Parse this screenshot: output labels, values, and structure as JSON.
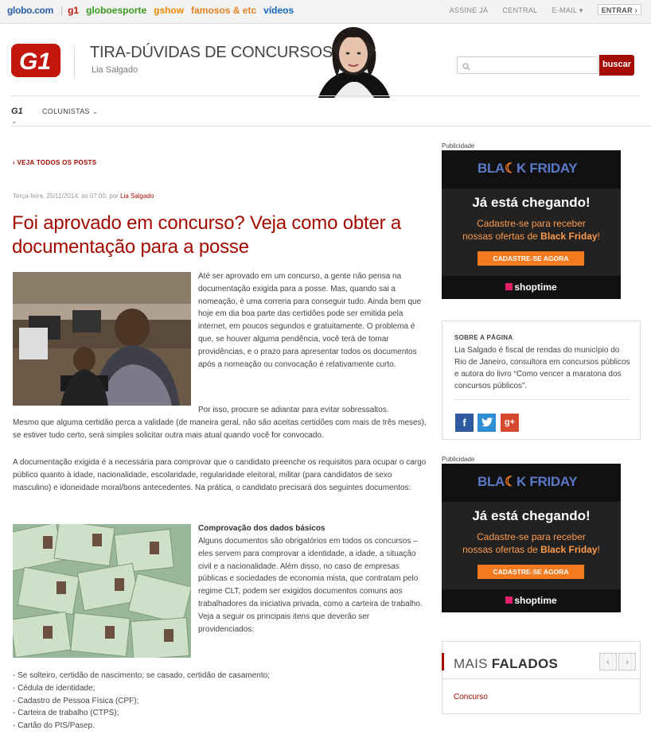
{
  "globobar": {
    "links": [
      "globo.com",
      "g1",
      "globoesporte",
      "gshow",
      "famosos & etc",
      "vídeos"
    ],
    "right": [
      "ASSINE JÁ",
      "CENTRAL",
      "E-MAIL",
      "ENTRAR"
    ]
  },
  "header": {
    "blog_title": "TIRA-DÚVIDAS DE CONCURSOS",
    "author": "Lia Salgado",
    "search_placeholder": "",
    "search_button": "buscar"
  },
  "nav": {
    "g1": "G1",
    "colunistas": "COLUNISTAS"
  },
  "post": {
    "back_link": "VEJA TODOS OS POSTS",
    "meta_date": "Terça-feira, 25/11/2014, às 07:00, por",
    "meta_author": "Lia Salgado",
    "title": "Foi aprovado em concurso? Veja como obter a documentação para a posse",
    "p1": "Até ser aprovado em um concurso, a gente não pensa na documentação exigida para a posse. Mas, quando sai a nomeação, é uma correria para conseguir tudo. Ainda bem que hoje em dia boa parte das certidões pode ser emitida pela internet, em poucos segundos e gratuitamente. O problema é que, se houver alguma pendência, você terá de tomar providências, e o prazo para apresentar todos os documentos após a nomeação ou convocação é relativamente curto.",
    "p2a": "Por isso, procure se adiantar para evitar sobressaltos.",
    "p2b": "Mesmo que alguma certidão perca a validade (de maneira geral, não são aceitas certidões com mais de três meses), se estiver tudo certo, será simples solicitar outra mais atual quando você for convocado.",
    "p3": "A documentação exigida é a necessária para comprovar que o candidato preenche os requisitos para ocupar o cargo público quanto à idade, nacionalidade, escolaridade, regularidade eleitoral, militar (para candidatos de sexo masculino) e idoneidade moral/bons antecedentes. Na prática, o candidato precisará dos seguintes documentos:",
    "subtitle": "Comprovação dos dados básicos",
    "p4": "Alguns documentos são obrigatórios em todos os concursos – eles servem para comprovar a identidade, a idade, a situação civil e a nacionalidade. Além disso, no caso de empresas públicas e sociedades de economia mista, que contratam pelo regime CLT, podem ser exigidos documentos comuns aos trabalhadores da iniciativa privada, como a carteira de trabalho. Veja a seguir os principais itens que deverão ser providenciados:",
    "list": [
      "- Se solteiro, certidão de nascimento; se casado, certidão de casamento;",
      "- Cédula de identidade;",
      "- Cadastro de Pessoa Física (CPF);",
      "- Carteira de trabalho (CTPS);",
      "- Cartão do PIS/Pasep."
    ]
  },
  "sidebar": {
    "publicidade": "Publicidade",
    "ad": {
      "headline_a": "BLA",
      "headline_b": "K FRIDAY",
      "chegando": "Já está chegando!",
      "line1": "Cadastre-se para receber",
      "line2": "nossas ofertas de",
      "line2b": "Black Friday",
      "line2c": "!",
      "button": "CADASTRE-SE AGORA",
      "brand": "shoptime"
    },
    "about": {
      "heading": "SOBRE A PÁGINA",
      "text": "Lia Salgado é fiscal de rendas do município do Rio de Janeiro, consultora em concursos públicos e autora do livro “Como vencer a maratona dos concursos públicos”."
    },
    "mais": {
      "label_a": "MAIS",
      "label_b": "FALADOS",
      "item": "Concurso"
    }
  }
}
